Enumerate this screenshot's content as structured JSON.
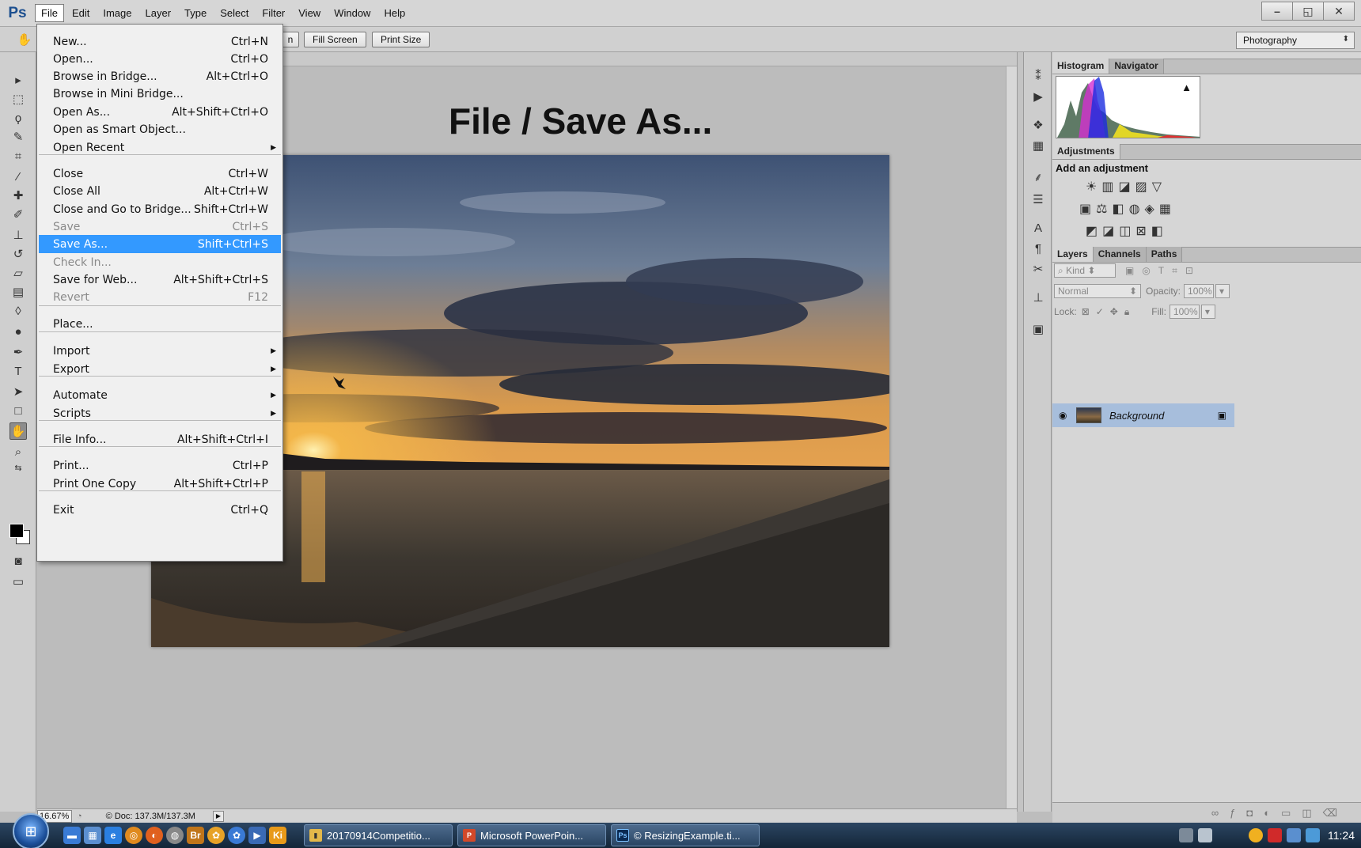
{
  "app": {
    "logo": "Ps",
    "menus": [
      "File",
      "Edit",
      "Image",
      "Layer",
      "Type",
      "Select",
      "Filter",
      "View",
      "Window",
      "Help"
    ],
    "window_controls": [
      "–",
      "◱",
      "✕"
    ]
  },
  "options_bar": {
    "partial_button": "n",
    "fill_screen": "Fill Screen",
    "print_size": "Print Size",
    "workspace": "Photography"
  },
  "slide_heading": "File / Save As...",
  "file_menu": {
    "items": [
      {
        "label": "New...",
        "shortcut": "Ctrl+N",
        "state": "normal"
      },
      {
        "label": "Open...",
        "shortcut": "Ctrl+O",
        "state": "normal"
      },
      {
        "label": "Browse in Bridge...",
        "shortcut": "Alt+Ctrl+O",
        "state": "normal"
      },
      {
        "label": "Browse in Mini Bridge...",
        "shortcut": "",
        "state": "normal"
      },
      {
        "label": "Open As...",
        "shortcut": "Alt+Shift+Ctrl+O",
        "state": "normal"
      },
      {
        "label": "Open as Smart Object...",
        "shortcut": "",
        "state": "normal"
      },
      {
        "label": "Open Recent",
        "shortcut": "",
        "state": "submenu"
      },
      {
        "label": "Close",
        "shortcut": "Ctrl+W",
        "state": "normal"
      },
      {
        "label": "Close All",
        "shortcut": "Alt+Ctrl+W",
        "state": "normal"
      },
      {
        "label": "Close and Go to Bridge...",
        "shortcut": "Shift+Ctrl+W",
        "state": "normal"
      },
      {
        "label": "Save",
        "shortcut": "Ctrl+S",
        "state": "disabled"
      },
      {
        "label": "Save As...",
        "shortcut": "Shift+Ctrl+S",
        "state": "highlighted"
      },
      {
        "label": "Check In...",
        "shortcut": "",
        "state": "disabled"
      },
      {
        "label": "Save for Web...",
        "shortcut": "Alt+Shift+Ctrl+S",
        "state": "normal"
      },
      {
        "label": "Revert",
        "shortcut": "F12",
        "state": "disabled"
      },
      {
        "label": "Place...",
        "shortcut": "",
        "state": "normal"
      },
      {
        "label": "Import",
        "shortcut": "",
        "state": "submenu"
      },
      {
        "label": "Export",
        "shortcut": "",
        "state": "submenu"
      },
      {
        "label": "Automate",
        "shortcut": "",
        "state": "submenu"
      },
      {
        "label": "Scripts",
        "shortcut": "",
        "state": "submenu"
      },
      {
        "label": "File Info...",
        "shortcut": "Alt+Shift+Ctrl+I",
        "state": "normal"
      },
      {
        "label": "Print...",
        "shortcut": "Ctrl+P",
        "state": "normal"
      },
      {
        "label": "Print One Copy",
        "shortcut": "Alt+Shift+Ctrl+P",
        "state": "normal"
      },
      {
        "label": "Exit",
        "shortcut": "Ctrl+Q",
        "state": "normal"
      }
    ]
  },
  "status_bar": {
    "zoom": "16.67%",
    "doc_info": "© Doc: 137.3M/137.3M"
  },
  "panels": {
    "histogram_tabs": [
      "Histogram",
      "Navigator"
    ],
    "adjustments_tab": "Adjustments",
    "adjustments_title": "Add an adjustment",
    "layers_tabs": [
      "Layers",
      "Channels",
      "Paths"
    ],
    "kind_filter": "Kind",
    "blend_mode": "Normal",
    "opacity_label": "Opacity:",
    "opacity_value": "100%",
    "lock_label": "Lock:",
    "fill_label": "Fill:",
    "fill_value": "100%",
    "layer_name": "Background"
  },
  "taskbar": {
    "tasks": [
      "20170914Competitio...",
      "Microsoft PowerPoin...",
      "© ResizingExample.ti..."
    ],
    "clock": "11:24"
  },
  "colors": {
    "menu_highlight": "#3399ff",
    "layer_selected": "#a7bedc"
  }
}
